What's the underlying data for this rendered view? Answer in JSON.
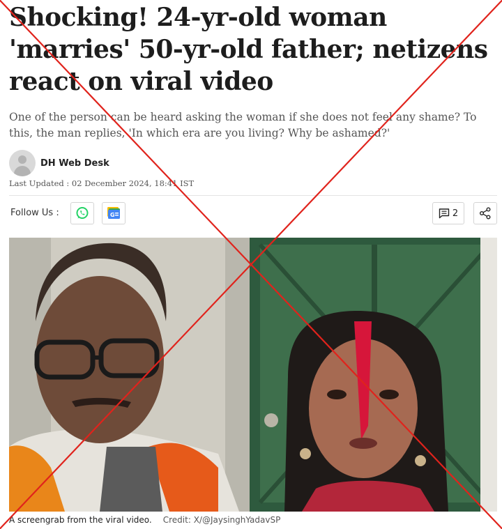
{
  "article": {
    "headline": "Shocking! 24-yr-old woman 'marries' 50-yr-old father; netizens react on viral video",
    "subheadline": "One of the person can be heard asking the woman if she does not feel any shame? To this, the man replies, 'In which era are you living? Why be ashamed?'",
    "author": "DH Web Desk",
    "last_updated": "Last Updated : 02 December 2024, 18:41 IST"
  },
  "share_bar": {
    "follow_label": "Follow Us :",
    "whatsapp_icon": "whatsapp-icon",
    "google_news_icon": "google-news-icon",
    "comment_icon": "comment-icon",
    "comment_count": "2",
    "share_icon": "share-icon"
  },
  "image": {
    "caption": "A screengrab from the viral video.",
    "credit": "Credit: X/@JaysinghYadavSP"
  },
  "overlay": {
    "mark": "red-cross",
    "color": "#e0231c"
  },
  "colors": {
    "whatsapp": "#25d366",
    "google_news_blue": "#4285f4"
  }
}
